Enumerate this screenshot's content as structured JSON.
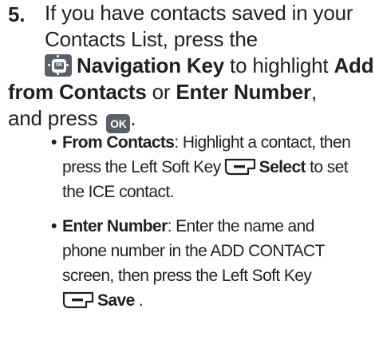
{
  "step": {
    "number": "5.",
    "line1": "If you have contacts saved in your",
    "line2": "Contacts List, press the",
    "nav_key_icon": "navigation-key-icon",
    "nav_key_center_label": "OK",
    "nav_key_label": "Navigation Key",
    "line3_mid": " to highlight ",
    "add_from_contacts_a": "Add",
    "add_from_contacts_b": "from Contacts",
    "or_text": " or ",
    "enter_number": "Enter Number",
    "comma": ",",
    "and_press": "and press",
    "ok_key_label": "OK",
    "period": "."
  },
  "bullets": [
    {
      "marker": "•",
      "title": "From Contacts",
      "text_1": ": Highlight a contact, then",
      "text_2_before": "press the Left Soft Key",
      "softkey_icon": "left-soft-key-icon",
      "action": "Select",
      "text_2_after": " to set",
      "text_3": "the ICE contact."
    },
    {
      "marker": "•",
      "title": "Enter Number",
      "text_1": ": Enter the name and",
      "text_2": "phone number in the ADD CONTACT",
      "text_3": "screen, then press the Left Soft Key",
      "softkey_icon": "left-soft-key-icon",
      "action": "Save",
      "text_4_after": " ."
    }
  ],
  "colors": {
    "text": "#231f20",
    "key_fill": "#5b6068",
    "key_text": "#ffffff"
  }
}
